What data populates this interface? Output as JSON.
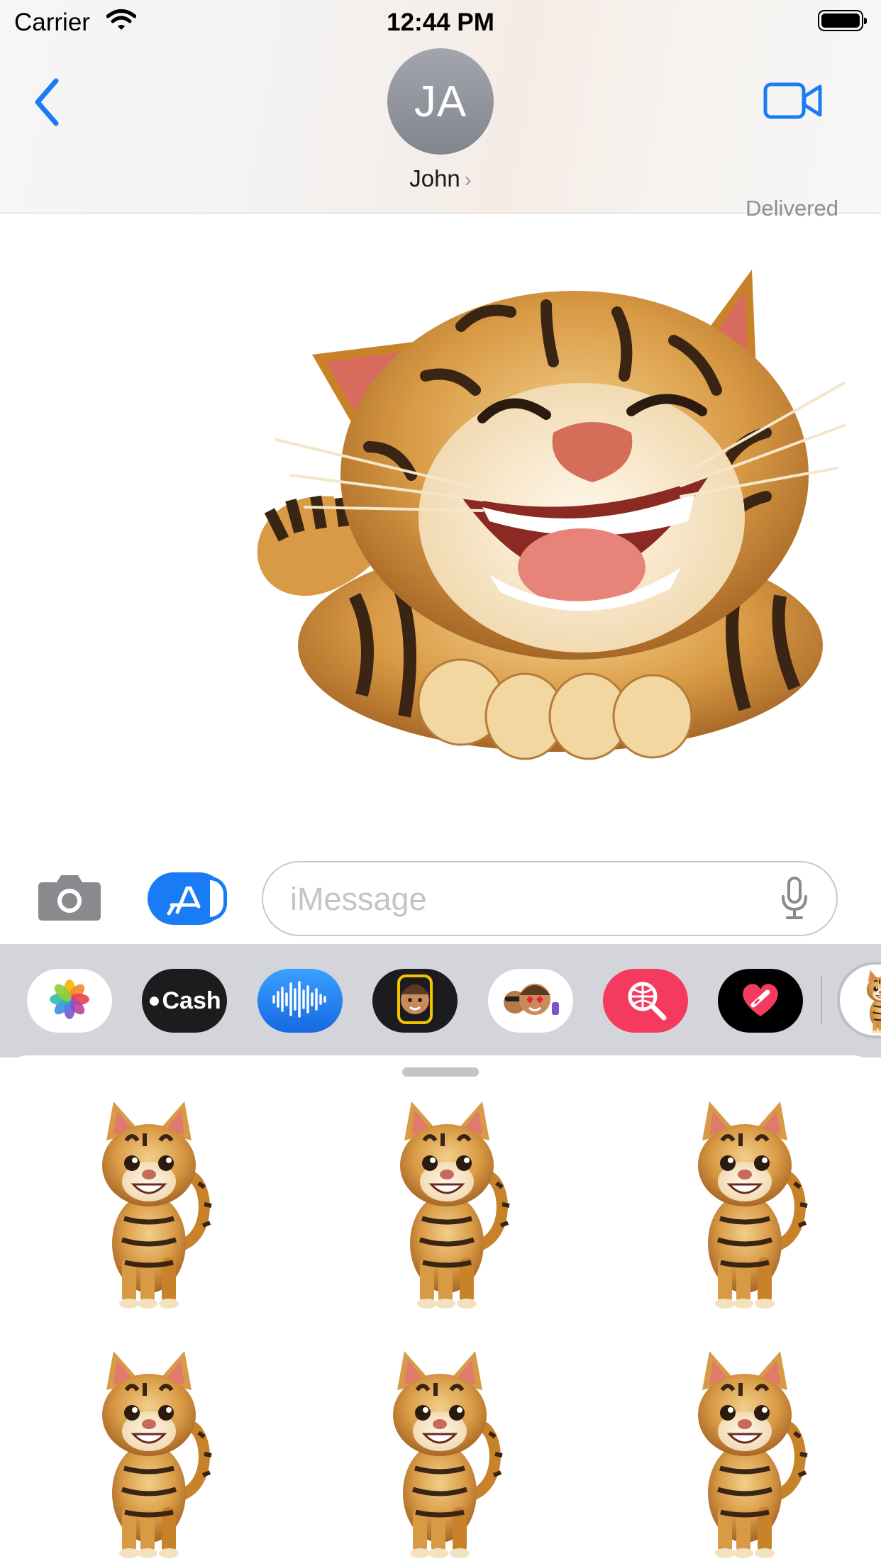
{
  "status_bar": {
    "carrier": "Carrier",
    "time": "12:44 PM"
  },
  "nav": {
    "avatar_initials": "JA",
    "contact_name": "John",
    "contact_chevron": "›",
    "back_icon": "chevron-left-icon",
    "video_icon": "video-camera-icon"
  },
  "conversation": {
    "status_text": "Delivered"
  },
  "compose": {
    "placeholder": "iMessage",
    "camera_icon": "camera-icon",
    "appstore_icon": "app-store-icon",
    "mic_icon": "microphone-icon"
  },
  "app_drawer": {
    "apps": [
      {
        "name": "Photos",
        "icon": "photos-icon"
      },
      {
        "name": "Apple Cash",
        "label": "Cash",
        "icon": "apple-cash-icon"
      },
      {
        "name": "Audio",
        "icon": "audio-waveform-icon"
      },
      {
        "name": "Memoji",
        "icon": "memoji-icon"
      },
      {
        "name": "Memoji Stickers",
        "icon": "memoji-stickers-icon"
      },
      {
        "name": "Images Search",
        "icon": "globe-search-icon"
      },
      {
        "name": "Digital Touch",
        "icon": "heart-icon"
      },
      {
        "name": "Cat Stickers",
        "icon": "cat-sticker-icon"
      }
    ]
  },
  "sticker_panel": {
    "stickers": [
      {
        "id": "cat-sticker-1",
        "icon": "cat-sticker"
      },
      {
        "id": "cat-sticker-2",
        "icon": "cat-sticker"
      },
      {
        "id": "cat-sticker-3",
        "icon": "cat-sticker"
      },
      {
        "id": "cat-sticker-4",
        "icon": "cat-sticker"
      },
      {
        "id": "cat-sticker-5",
        "icon": "cat-sticker"
      },
      {
        "id": "cat-sticker-6",
        "icon": "cat-sticker"
      }
    ]
  },
  "colors": {
    "accent": "#1a7cf5",
    "cat_orange": "#c8832a",
    "cat_stripe": "#3a2414",
    "cat_ear": "#e07a6c"
  }
}
